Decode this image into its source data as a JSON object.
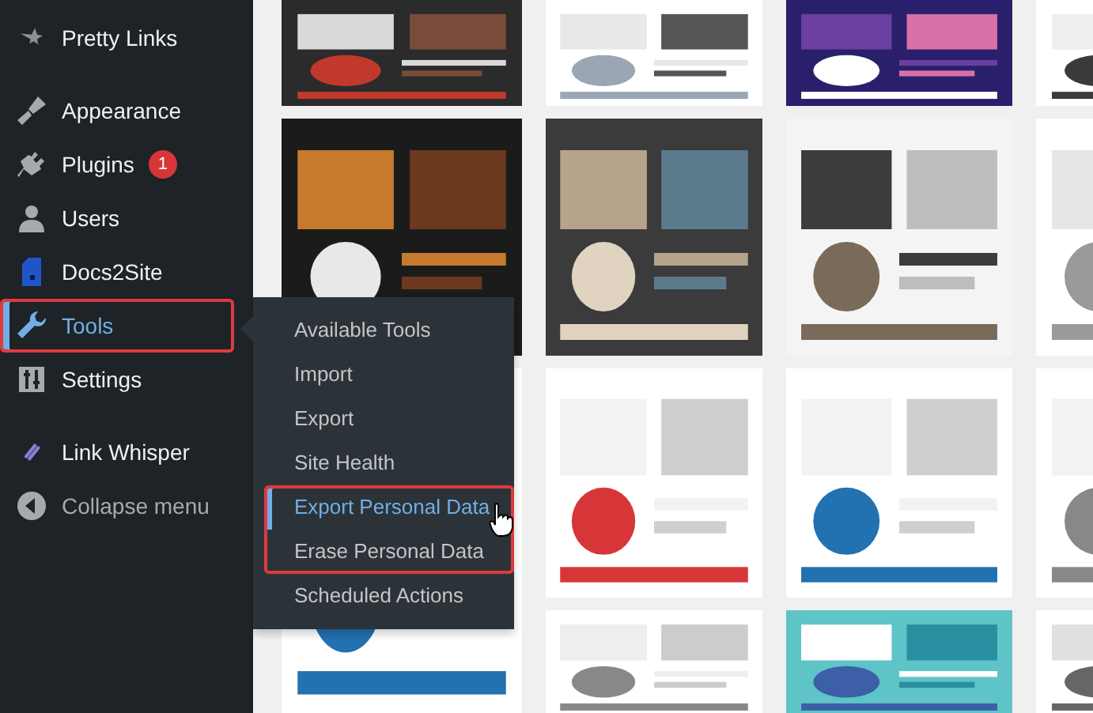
{
  "sidebar": {
    "items": [
      {
        "label": "Pretty Links",
        "selected": false,
        "highlighted": false
      },
      {
        "label": "Appearance",
        "selected": false,
        "highlighted": false
      },
      {
        "label": "Plugins",
        "selected": false,
        "highlighted": false,
        "badge": "1"
      },
      {
        "label": "Users",
        "selected": false,
        "highlighted": false
      },
      {
        "label": "Docs2Site",
        "selected": false,
        "highlighted": false
      },
      {
        "label": "Tools",
        "selected": true,
        "highlighted": true
      },
      {
        "label": "Settings",
        "selected": false,
        "highlighted": false
      },
      {
        "label": "Link Whisper",
        "selected": false,
        "highlighted": false
      },
      {
        "label": "Collapse menu",
        "selected": false,
        "highlighted": false
      }
    ]
  },
  "submenu": {
    "items": [
      {
        "label": "Available Tools",
        "selected": false,
        "highlighted": false
      },
      {
        "label": "Import",
        "selected": false,
        "highlighted": false
      },
      {
        "label": "Export",
        "selected": false,
        "highlighted": false
      },
      {
        "label": "Site Health",
        "selected": false,
        "highlighted": false
      },
      {
        "label": "Export Personal Data",
        "selected": true,
        "highlighted": true
      },
      {
        "label": "Erase Personal Data",
        "selected": false,
        "highlighted": true
      },
      {
        "label": "Scheduled Actions",
        "selected": false,
        "highlighted": false
      }
    ]
  }
}
